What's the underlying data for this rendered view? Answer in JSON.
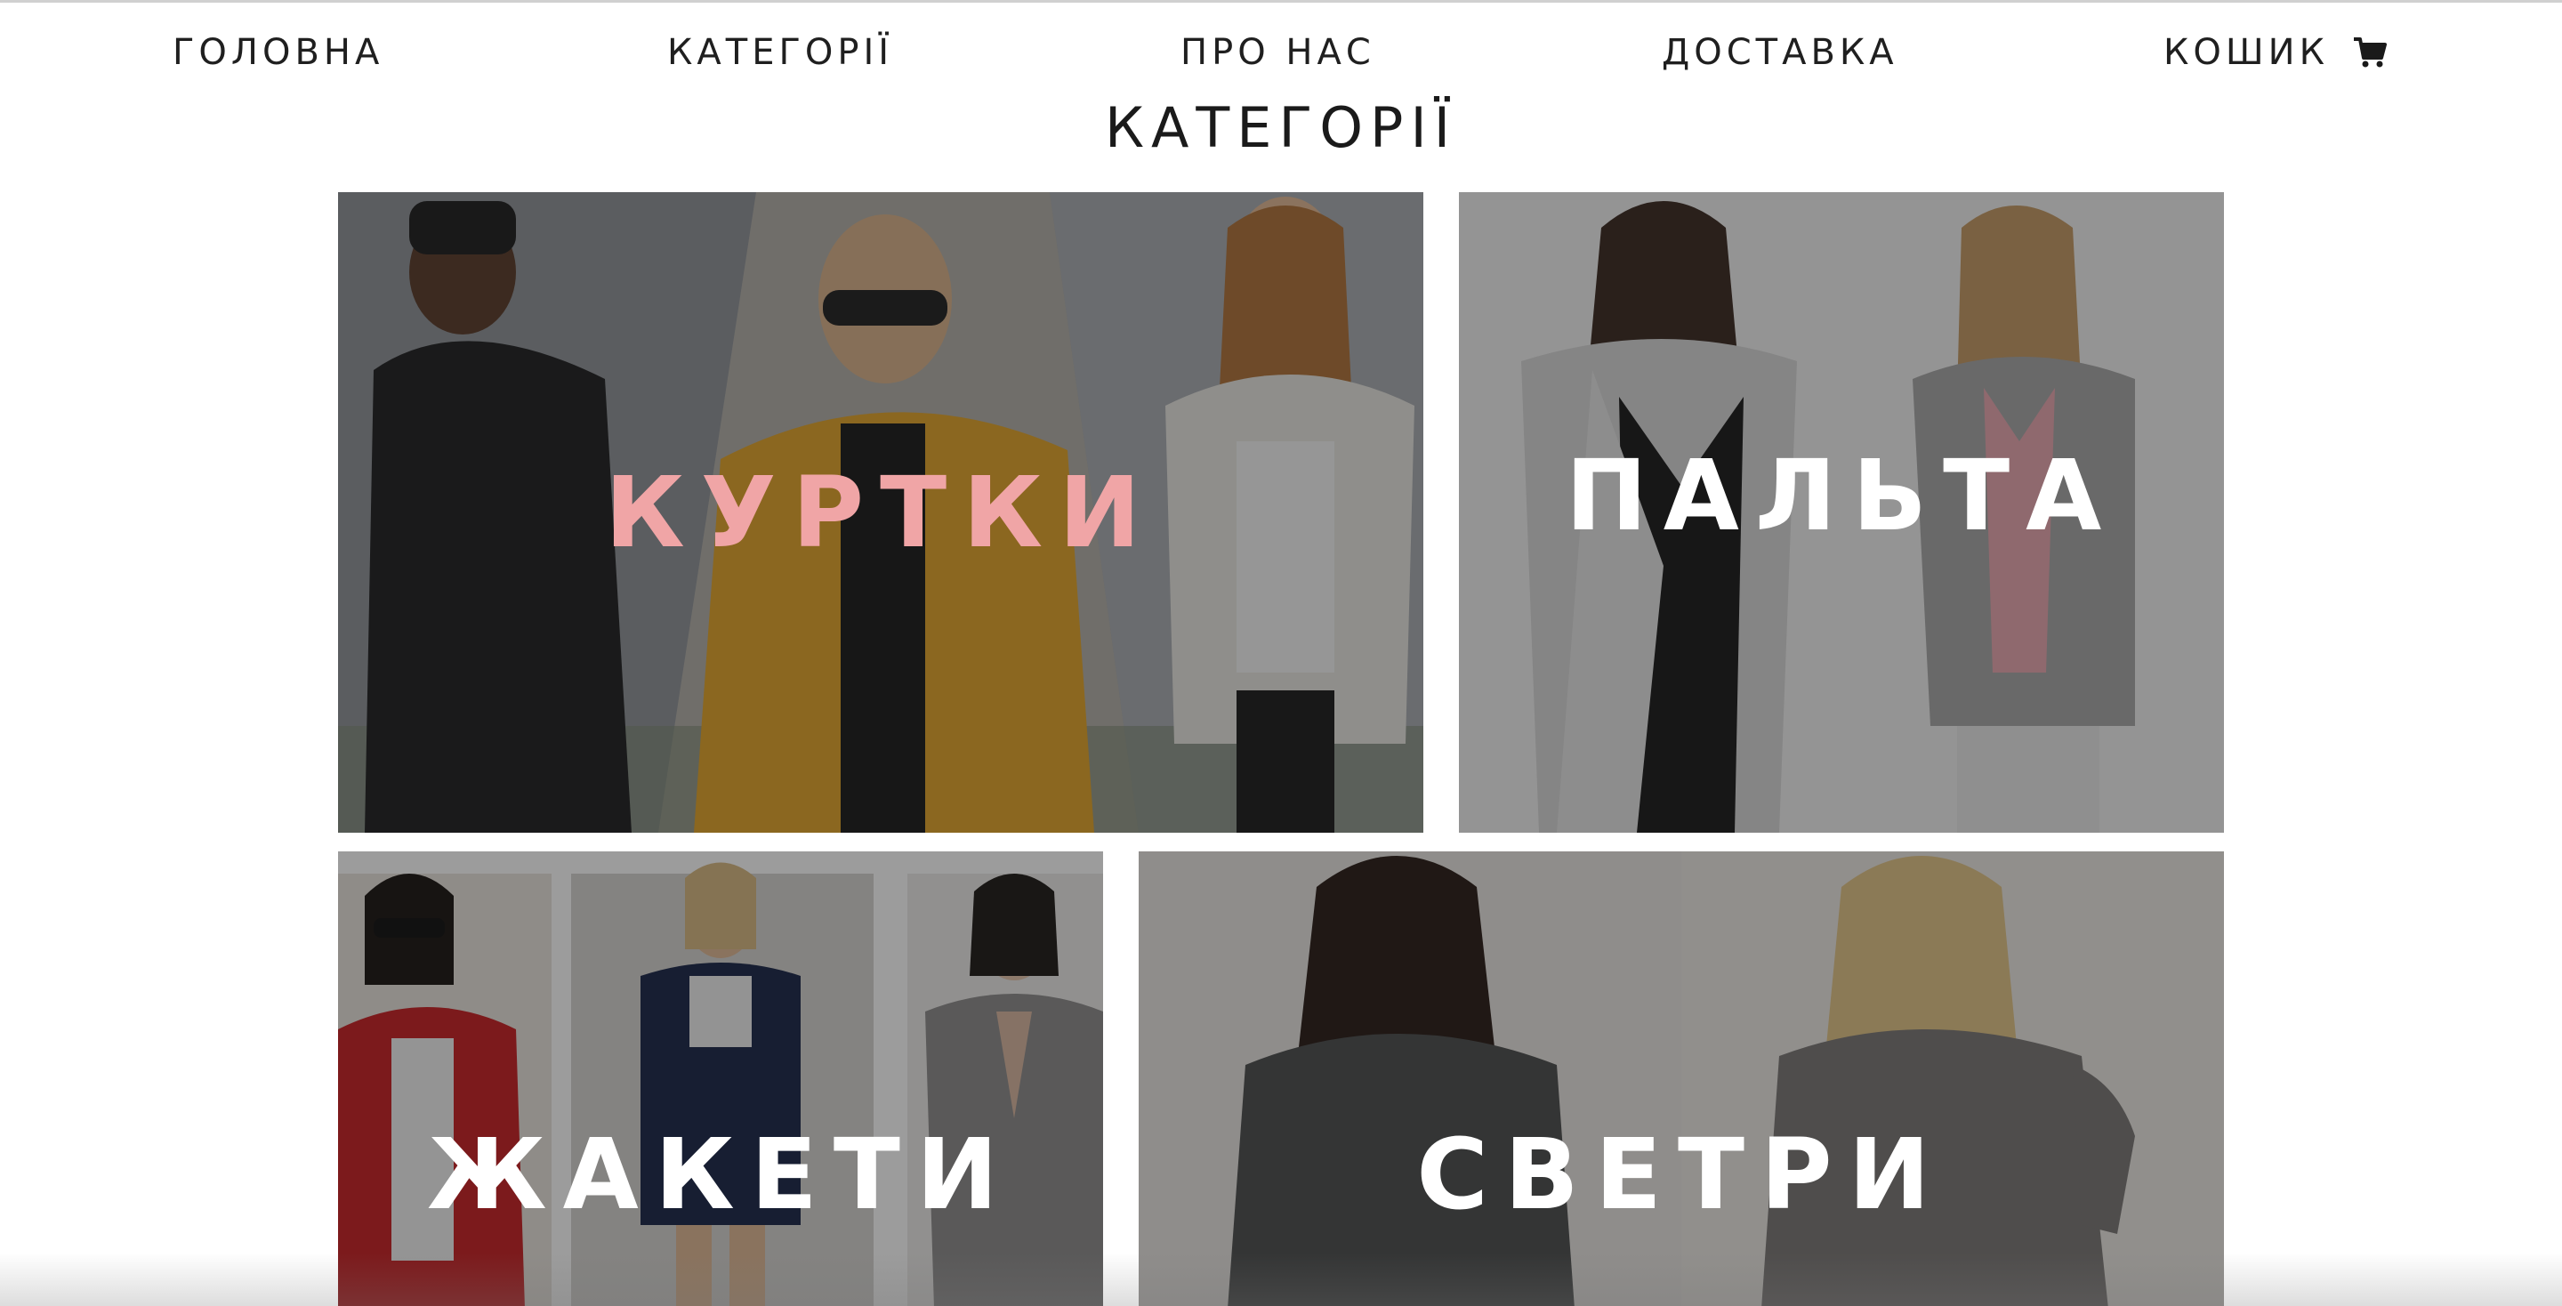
{
  "nav": {
    "home": "ГОЛОВНА",
    "categories": "КАТЕГОРІЇ",
    "about": "ПРО НАС",
    "delivery": "ДОСТАВКА",
    "cart": "КОШИК"
  },
  "page_title": "КАТЕГОРІЇ",
  "categories": [
    {
      "label": "КУРТКИ",
      "label_color": "#f0a5a6"
    },
    {
      "label": "ПАЛЬТА",
      "label_color": "#ffffff"
    },
    {
      "label": "ЖАКЕТИ",
      "label_color": "#ffffff"
    },
    {
      "label": "СВЕТРИ",
      "label_color": "#ffffff"
    }
  ],
  "colors": {
    "text": "#1f1f1f",
    "accent_pink": "#f0a5a6",
    "overlay": "rgba(20,20,20,0.42)"
  },
  "icons": {
    "cart": "shopping-cart-icon"
  }
}
